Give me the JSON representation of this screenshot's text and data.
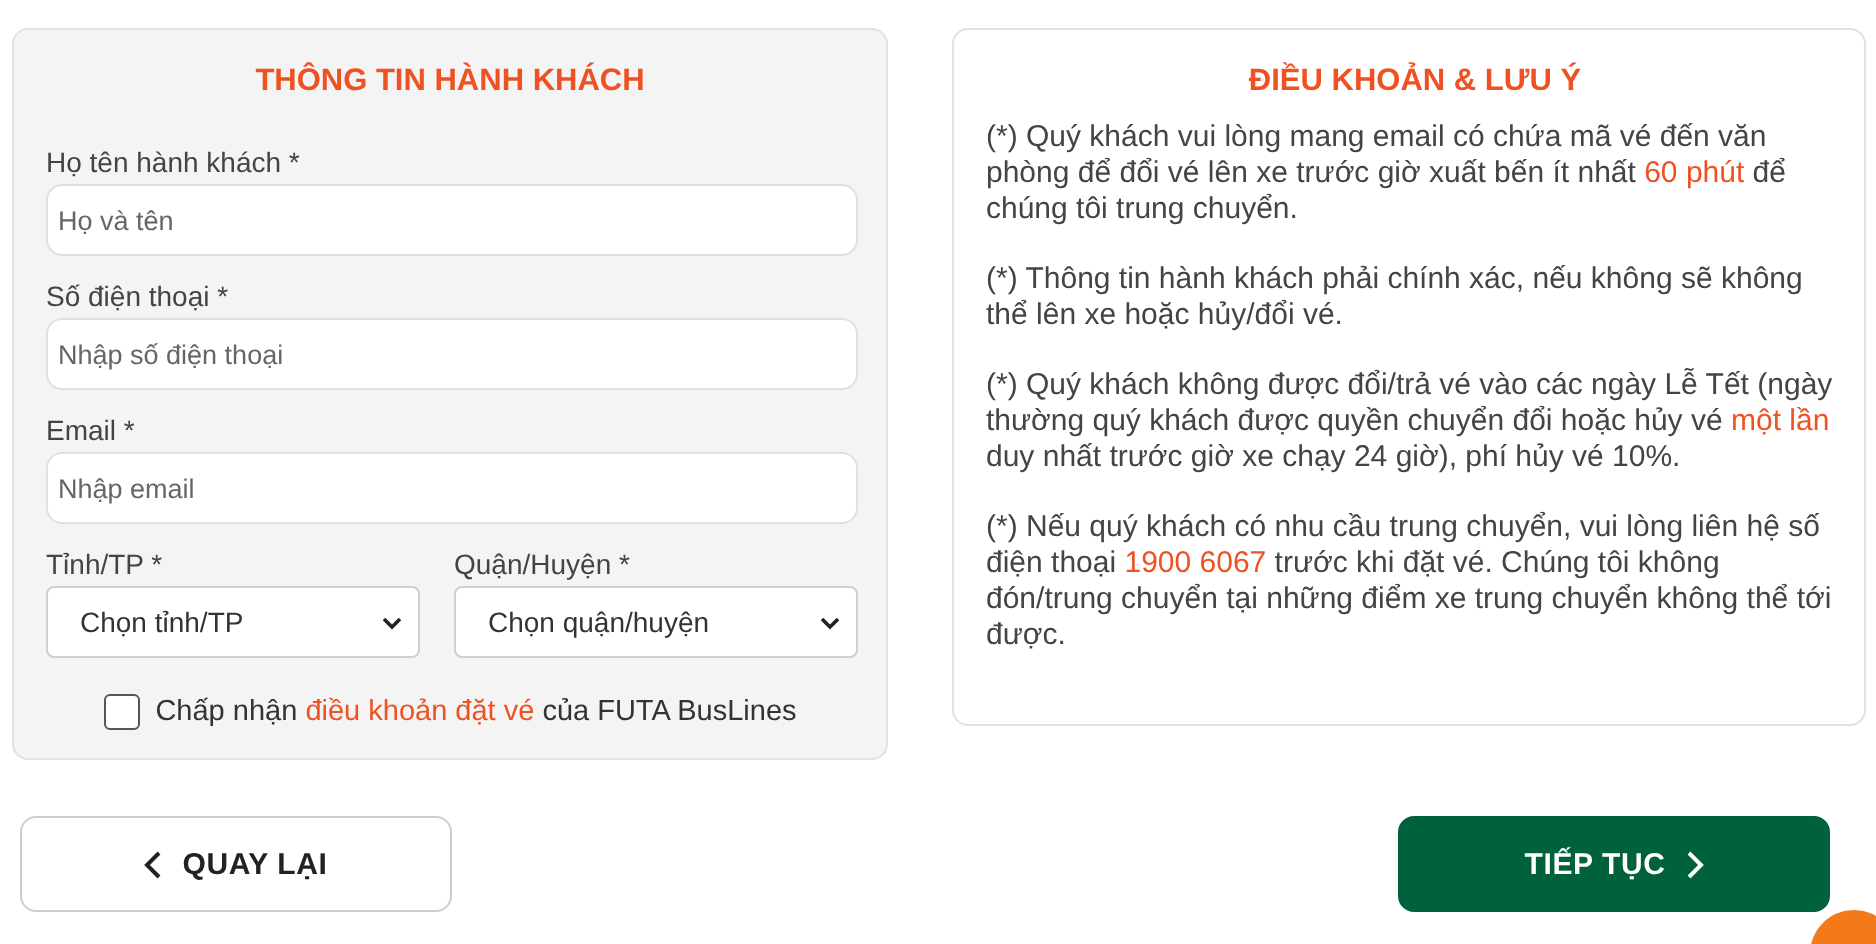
{
  "passenger_form": {
    "title": "THÔNG TIN HÀNH KHÁCH",
    "fields": [
      {
        "label": "Họ tên hành khách *",
        "placeholder": "Họ và tên"
      },
      {
        "label": "Số điện thoại *",
        "placeholder": "Nhập số điện thoại"
      },
      {
        "label": "Email *",
        "placeholder": "Nhập email"
      }
    ],
    "selects": [
      {
        "label": "Tỉnh/TP *",
        "value": "Chọn tỉnh/TP"
      },
      {
        "label": "Quận/Huyện *",
        "value": "Chọn quận/huyện"
      }
    ],
    "agreement": {
      "checked": false,
      "before": "Chấp nhận",
      "link": "điều khoản đặt vé",
      "after": "của FUTA BusLines"
    }
  },
  "terms": {
    "title": "ĐIỀU KHOẢN & LƯU Ý",
    "paragraphs": [
      "(*) Quý khách vui lòng mang email có chứa mã vé đến văn phòng để đổi vé lên xe trước giờ xuất bến ít nhất **60 phút** để chúng tôi trung chuyển.",
      "(*) Thông tin hành khách phải chính xác, nếu không sẽ không thể lên xe hoặc hủy/đổi vé.",
      "(*) Quý khách không được đổi/trả vé vào các ngày Lễ Tết (ngày thường quý khách được quyền chuyển đổi hoặc hủy vé **một lần** duy nhất trước giờ xe chạy 24 giờ), phí hủy vé 10%.",
      "(*) Nếu quý khách có nhu cầu trung chuyển, vui lòng liên hệ số điện thoại **1900 6067** trước khi đặt vé. Chúng tôi không đón/trung chuyển tại những điểm xe trung chuyển không thể tới được."
    ]
  },
  "buttons": [
    {
      "kind": "back",
      "label": "QUAY LẠI"
    },
    {
      "kind": "next",
      "label": "TIẾP TỤC"
    }
  ]
}
